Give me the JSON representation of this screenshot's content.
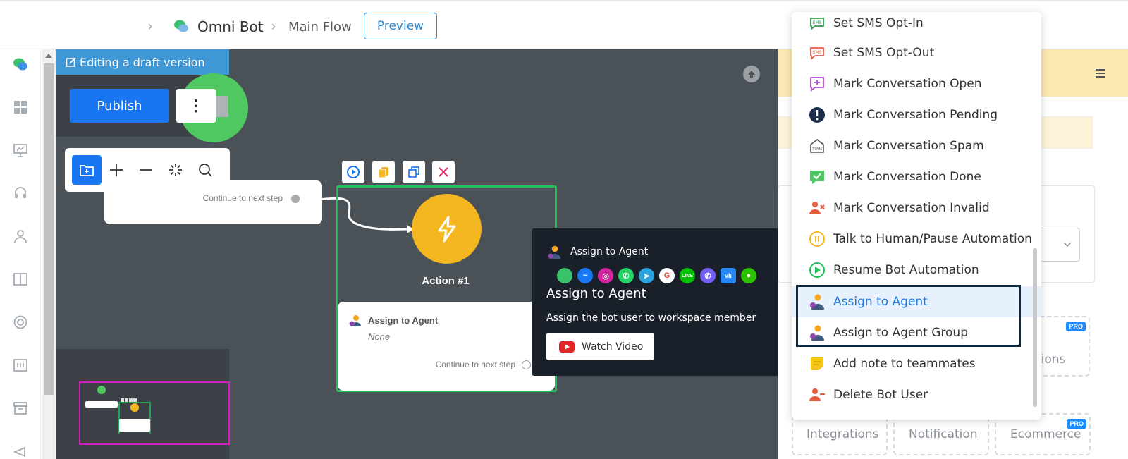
{
  "header": {
    "bot_name": "Omni Bot",
    "flow_name": "Main Flow",
    "preview_label": "Preview"
  },
  "canvas": {
    "draft_label": "Editing a draft version",
    "publish_label": "Publish",
    "prev_node_continue": "Continue to next step",
    "action_title": "Action #1",
    "action_card": {
      "title": "Assign to Agent",
      "value": "None",
      "continue": "Continue to next step"
    }
  },
  "tooltip": {
    "head": "Assign to Agent",
    "title": "Assign to Agent",
    "description": "Assign the bot user to workspace member",
    "watch_label": "Watch Video",
    "channels": [
      "omni-chat-icon",
      "messenger-icon",
      "instagram-icon",
      "whatsapp-icon",
      "telegram-icon",
      "google-icon",
      "line-icon",
      "viber-icon",
      "vk-icon",
      "wechat-icon"
    ]
  },
  "dropdown": {
    "items": [
      {
        "label": "Set SMS Opt-In",
        "icon": "sms-optin-icon"
      },
      {
        "label": "Set SMS Opt-Out",
        "icon": "sms-optout-icon"
      },
      {
        "label": "Mark Conversation Open",
        "icon": "conversation-open-icon"
      },
      {
        "label": "Mark Conversation Pending",
        "icon": "conversation-pending-icon"
      },
      {
        "label": "Mark Conversation Spam",
        "icon": "conversation-spam-icon"
      },
      {
        "label": "Mark Conversation Done",
        "icon": "conversation-done-icon"
      },
      {
        "label": "Mark Conversation Invalid",
        "icon": "conversation-invalid-icon"
      },
      {
        "label": "Talk to Human/Pause Automation",
        "icon": "pause-icon"
      },
      {
        "label": "Resume Bot Automation",
        "icon": "resume-icon"
      },
      {
        "label": "Assign to Agent",
        "icon": "agent-icon"
      },
      {
        "label": "Assign to Agent Group",
        "icon": "agent-group-icon"
      },
      {
        "label": "Add note to teammates",
        "icon": "note-icon"
      },
      {
        "label": "Delete Bot User",
        "icon": "delete-user-icon"
      }
    ]
  },
  "right_panel": {
    "card_partial_label": "tions",
    "pro_badge": "PRO",
    "integrations_label": "Integrations",
    "notification_label": "Notification",
    "ecommerce_label": "Ecommerce"
  },
  "colors": {
    "accent": "#1976f2",
    "canvas_bg": "#4a5157",
    "action_yellow": "#f5b71f",
    "frame_green": "#20c05a",
    "tooltip_bg": "#1a2029"
  }
}
